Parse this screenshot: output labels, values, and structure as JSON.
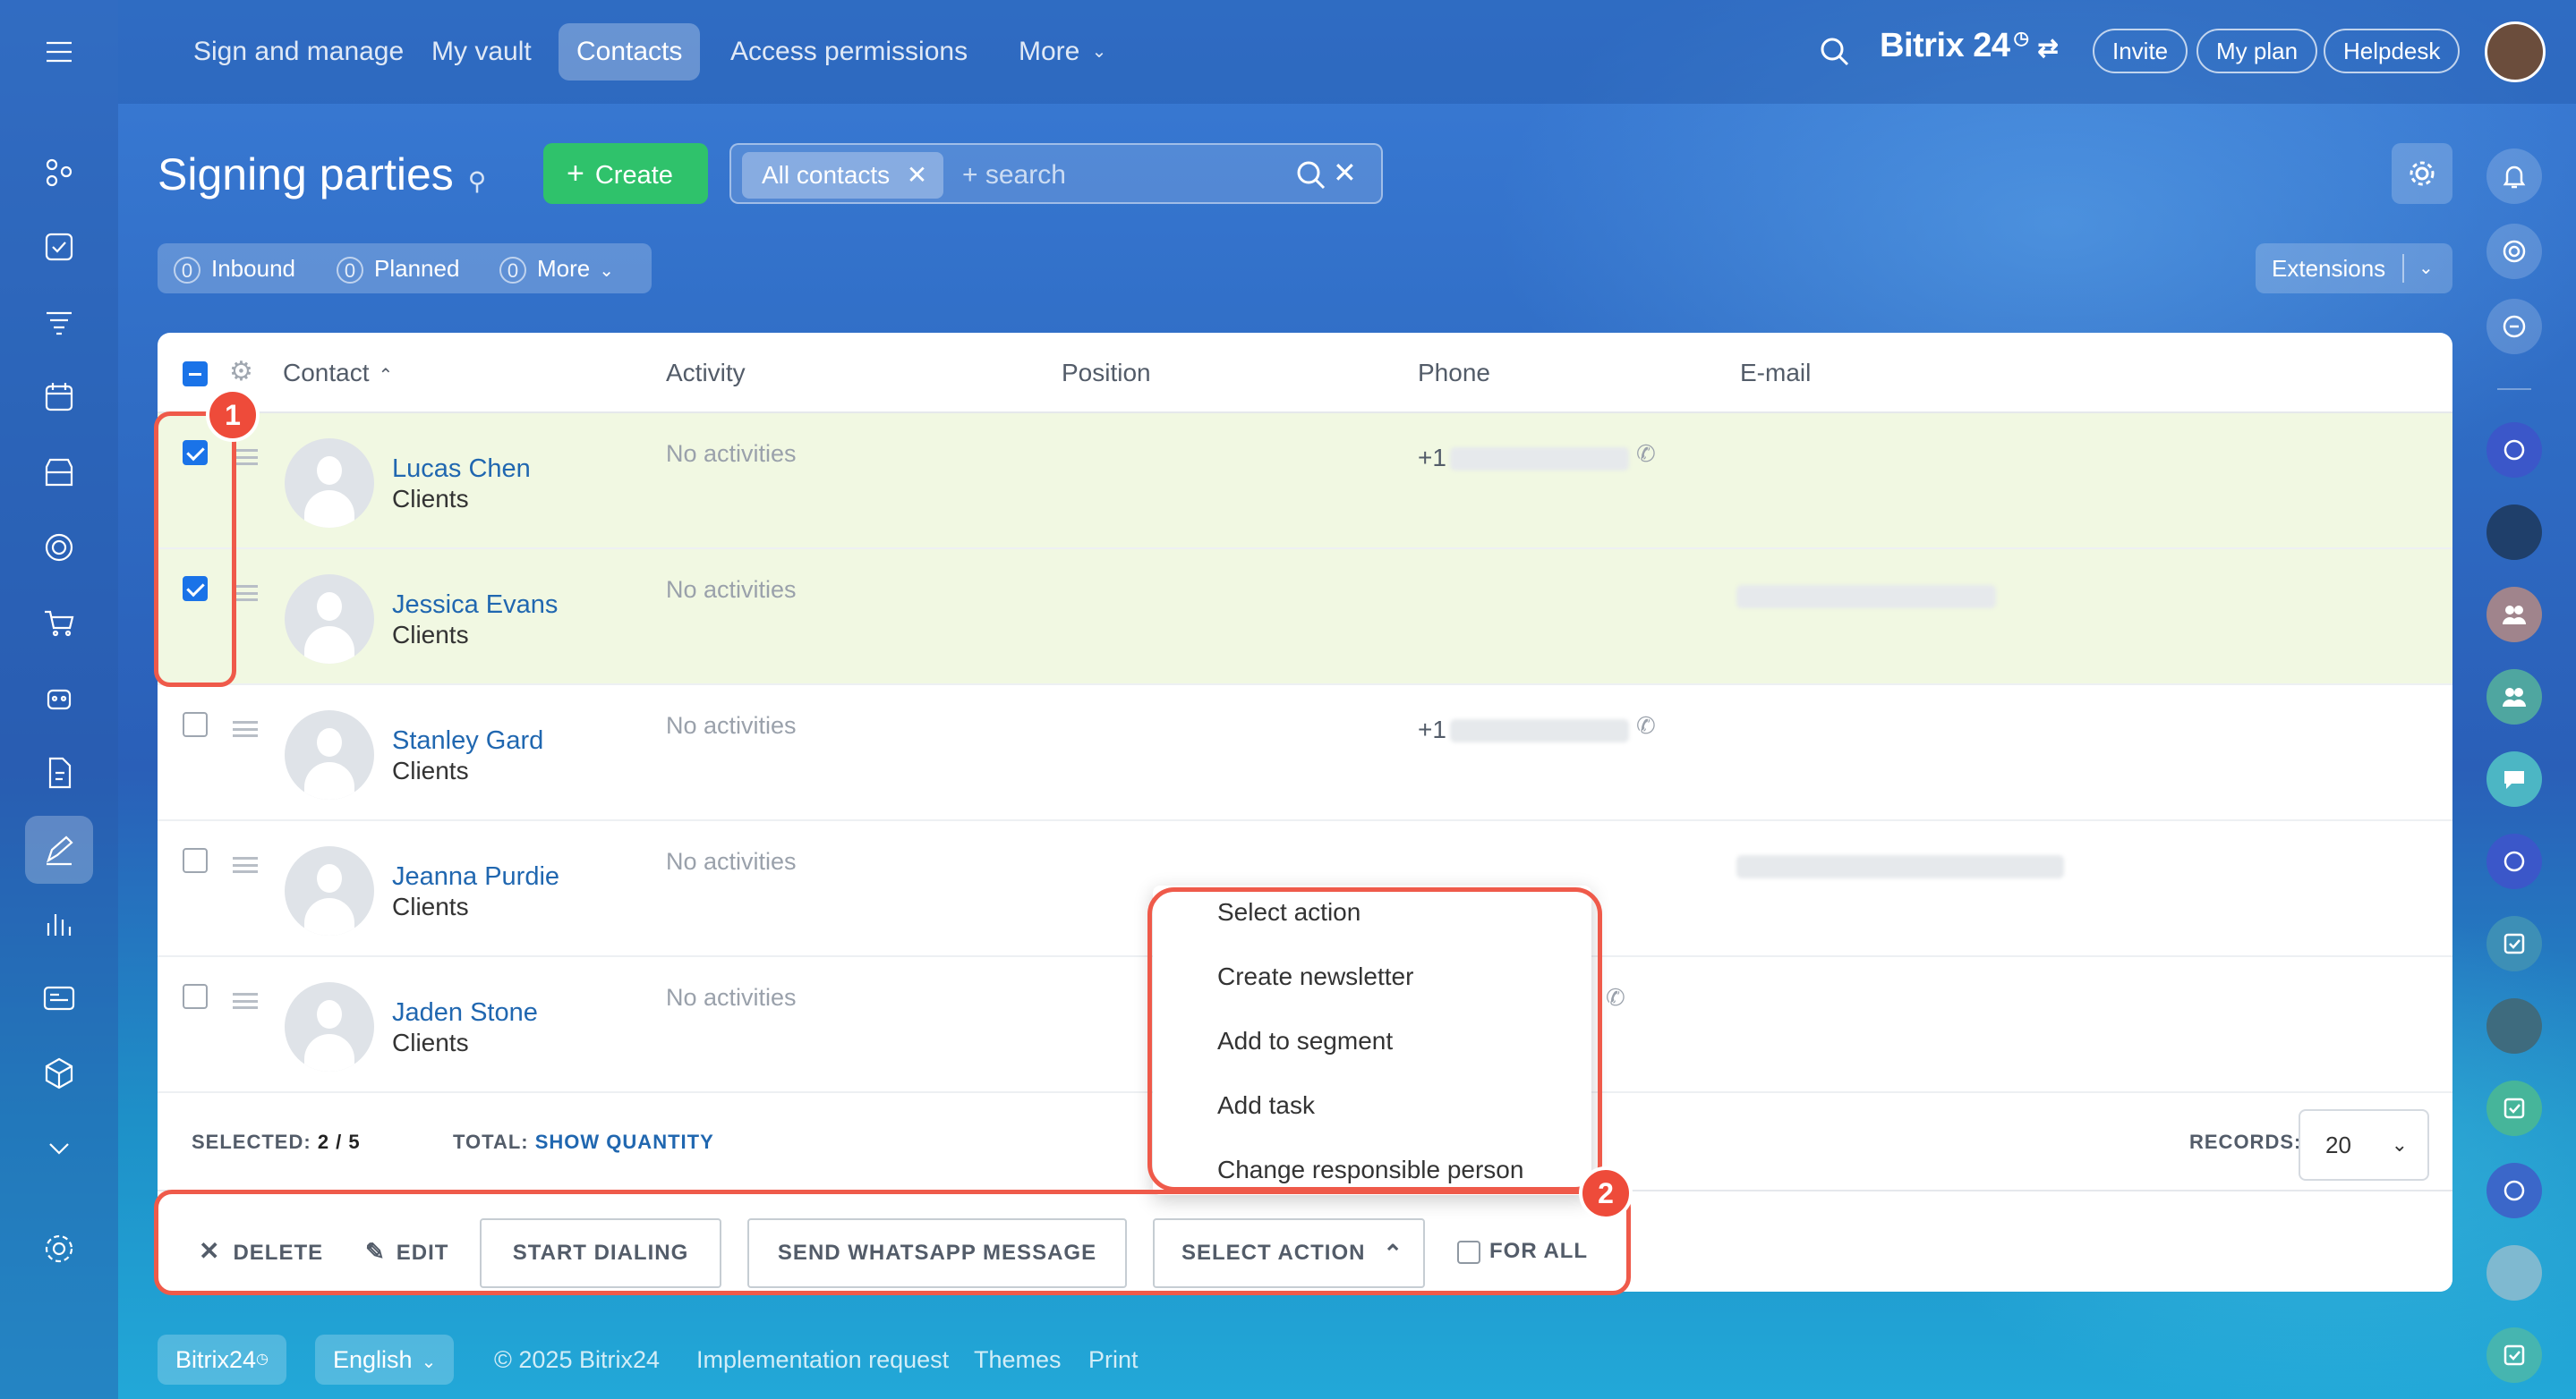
{
  "topnav": {
    "items": [
      "Sign and manage",
      "My vault",
      "Contacts",
      "Access permissions",
      "More"
    ],
    "brand": "Bitrix 24",
    "pills": [
      "Invite",
      "My plan",
      "Helpdesk"
    ]
  },
  "page": {
    "title": "Signing parties",
    "create_label": "Create",
    "filter_chip": "All contacts",
    "search_placeholder": "+ search",
    "extensions_label": "Extensions"
  },
  "counters": [
    {
      "count": "0",
      "label": "Inbound"
    },
    {
      "count": "0",
      "label": "Planned"
    },
    {
      "count": "0",
      "label": "More"
    }
  ],
  "grid": {
    "columns": [
      "Contact",
      "Activity",
      "Position",
      "Phone",
      "E-mail"
    ],
    "rows": [
      {
        "name": "Lucas Chen",
        "type": "Clients",
        "activity": "No activities",
        "phone": "+1",
        "selected": true
      },
      {
        "name": "Jessica Evans",
        "type": "Clients",
        "activity": "No activities",
        "phone": "",
        "selected": true
      },
      {
        "name": "Stanley Gard",
        "type": "Clients",
        "activity": "No activities",
        "phone": "+1",
        "selected": false
      },
      {
        "name": "Jeanna Purdie",
        "type": "Clients",
        "activity": "No activities",
        "phone": "",
        "selected": false
      },
      {
        "name": "Jaden Stone",
        "type": "Clients",
        "activity": "No activities",
        "phone": "",
        "selected": false
      }
    ],
    "footer": {
      "selected_label": "SELECTED:",
      "selected_value": "2 / 5",
      "total_label": "TOTAL:",
      "total_link": "SHOW QUANTITY",
      "records_label": "RECORDS:",
      "records_value": "20"
    }
  },
  "actions": {
    "delete": "DELETE",
    "edit": "EDIT",
    "start_dialing": "START DIALING",
    "send_whatsapp": "SEND WHATSAPP MESSAGE",
    "select_action": "SELECT ACTION",
    "for_all": "FOR ALL"
  },
  "action_menu": [
    "Select action",
    "Create newsletter",
    "Add to segment",
    "Add task",
    "Change responsible person"
  ],
  "badges": [
    "1",
    "2"
  ],
  "footer": {
    "brand": "Bitrix24",
    "language": "English",
    "copyright": "© 2025 Bitrix24",
    "links": [
      "Implementation request",
      "Themes",
      "Print"
    ]
  },
  "colors": {
    "accent_green": "#2fc26b",
    "link_blue": "#2067b0",
    "annotation_red": "#ef5a4a",
    "selected_row": "#f1f8e2"
  }
}
